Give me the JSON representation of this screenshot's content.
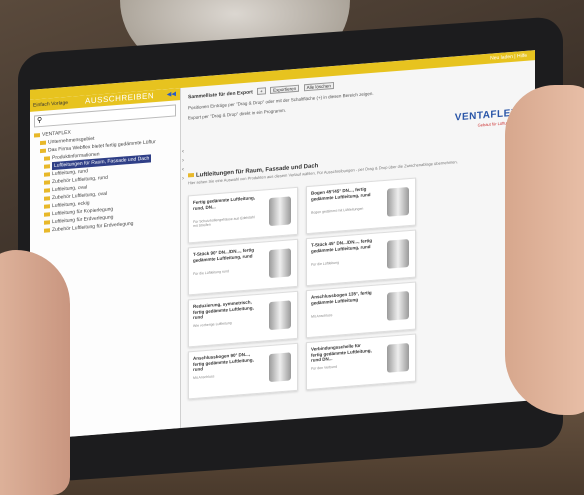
{
  "topbar": {
    "links": "Neu laden | Hilfe"
  },
  "sidebar": {
    "title": "AUSSCHREIBEN",
    "tools": "Einfach  Vorlage",
    "tree": [
      "VENTAFLEX",
      "Unternehmensgebiet",
      "Das Firma Webflex bietet fertig gedämmte Lüftur",
      "Produktinformationen",
      "Luftleitungen für Raum, Fassade und Dach",
      "Luftleitung, rund",
      "Zubehör Luftleitung, rund",
      "Luftleitung, oval",
      "Zubehör Luftleitung, oval",
      "Luftleitung, eckig",
      "Luftleitung für Kopierlegung",
      "Luftleitung für Erdverlegung",
      "Zubehör Luftleitung für Erdverlegung"
    ],
    "selected_index": 4
  },
  "main": {
    "sammel_title": "Sammelliste für den Export",
    "btn_export": "Exportieren",
    "btn_clear": "Alle löschen",
    "hint1": "Positionen Einträge per \"Drag & Drop\" oder mit der Schaltfläche (+) in diesen Bereich zeigen.",
    "hint2": "Export per \"Drag & Drop\" direkt in ein Programm.",
    "logo": "VENTAFLEX",
    "logo_sub": "Gebaut für Lüftung",
    "section_heading": "Luftleitungen für Raum, Fassade und Dach",
    "section_sub": "Hier sehen Sie eine Auswahl von Produkten aus diesem Verlauf wählen. Für Ausschreibungen - per Drag & Drop über die Zwischenablage übernehmen.",
    "cards": [
      {
        "title": "Fertig gedämmte Luftleitung, rund, DN...",
        "desc": "Für Schutzhüllengehäuse aus Edelstahl mit Streifen"
      },
      {
        "title": "Bogen 45°/45° DN..., fertig gedämmte Luftleitung, rund",
        "desc": "Bogen gedämmt mit Lüftleitungen"
      },
      {
        "title": "T-Stück 90° DN.../DN..., fertig gedämmte Luftleitung, rund",
        "desc": "Für die Lüftleitung rund"
      },
      {
        "title": "T-Stück 45° DN.../DN..., fertig gedämmte Luftleitung, rund",
        "desc": "Für die Lüftleitung"
      },
      {
        "title": "Reduzierung, symmetrisch, fertig gedämmte Luftleitung, rund",
        "desc": "Wie vorherige Luftleitung"
      },
      {
        "title": "Anschlussbogen 135°, fertig gedämmte Luftleitung",
        "desc": "Mit Anschluss"
      },
      {
        "title": "Anschlussbogen 90° DN..., fertig gedämmte Luftleitung, rund",
        "desc": "Mit Anschluss"
      },
      {
        "title": "Verbindungsschelle für fertig gedämmte Luftleitung, rund DN...",
        "desc": "Für den Verbund"
      }
    ]
  }
}
